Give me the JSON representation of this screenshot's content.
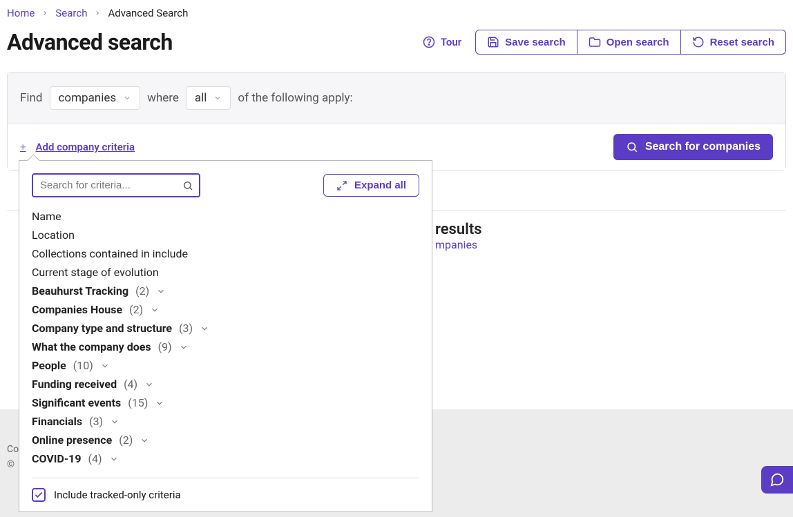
{
  "breadcrumb": {
    "home": "Home",
    "search": "Search",
    "current": "Advanced Search"
  },
  "page": {
    "title": "Advanced search"
  },
  "header": {
    "tour": "Tour",
    "save": "Save search",
    "open": "Open search",
    "reset": "Reset search"
  },
  "query": {
    "find_label": "Find",
    "find_value": "companies",
    "where_label": "where",
    "where_value": "all",
    "suffix": "of the following apply:",
    "add_criteria": "Add company criteria",
    "search_button": "Search for companies"
  },
  "popover": {
    "search_placeholder": "Search for criteria...",
    "expand_all": "Expand all",
    "items": [
      {
        "label": "Name",
        "type": "simple"
      },
      {
        "label": "Location",
        "type": "simple"
      },
      {
        "label": "Collections contained in include",
        "type": "simple"
      },
      {
        "label": "Current stage of evolution",
        "type": "simple"
      },
      {
        "label": "Beauhurst Tracking",
        "type": "group",
        "count": "(2)"
      },
      {
        "label": "Companies House",
        "type": "group",
        "count": "(2)"
      },
      {
        "label": "Company type and structure",
        "type": "group",
        "count": "(3)"
      },
      {
        "label": "What the company does",
        "type": "group",
        "count": "(9)"
      },
      {
        "label": "People",
        "type": "group",
        "count": "(10)"
      },
      {
        "label": "Funding received",
        "type": "group",
        "count": "(4)"
      },
      {
        "label": "Significant events",
        "type": "group",
        "count": "(15)"
      },
      {
        "label": "Financials",
        "type": "group",
        "count": "(3)"
      },
      {
        "label": "Online presence",
        "type": "group",
        "count": "(2)"
      },
      {
        "label": "COVID-19",
        "type": "group",
        "count": "(4)"
      }
    ],
    "include_tracked": "Include tracked-only criteria",
    "include_tracked_checked": true
  },
  "results": {
    "headline_suffix": "results",
    "subline_suffix": "mpanies"
  },
  "footer": {
    "line1_prefix": "Co",
    "line2_prefix": "©"
  }
}
